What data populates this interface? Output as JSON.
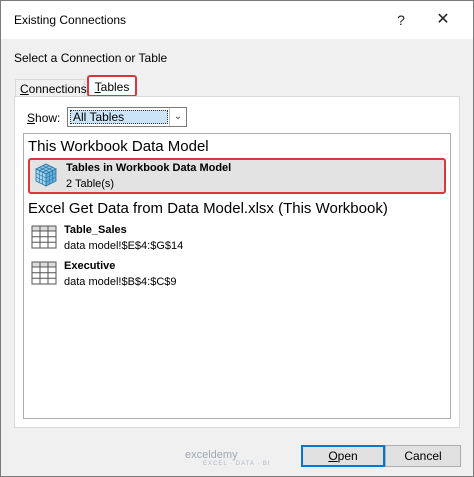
{
  "window": {
    "title": "Existing Connections",
    "help_label": "?",
    "close_label": "✕"
  },
  "prompt": "Select a Connection or Table",
  "tabs": [
    {
      "label_first": "C",
      "label_rest": "onnections"
    },
    {
      "label_first": "T",
      "label_rest": "ables"
    }
  ],
  "show": {
    "label_first": "S",
    "label_rest": "how:",
    "value": "All Tables"
  },
  "groups": [
    {
      "header": "This Workbook Data Model",
      "items": [
        {
          "name": "Tables in Workbook Data Model",
          "detail": "2 Table(s)",
          "icon": "data-model-cube-icon"
        }
      ]
    },
    {
      "header": "Excel Get Data from Data Model.xlsx (This Workbook)",
      "items": [
        {
          "name": "Table_Sales",
          "detail": "data model!$E$4:$G$14",
          "icon": "table-grid-icon"
        },
        {
          "name": "Executive",
          "detail": "data model!$B$4:$C$9",
          "icon": "table-grid-icon"
        }
      ]
    }
  ],
  "watermark": {
    "brand": "exceldemy",
    "tagline": "EXCEL · DATA · BI"
  },
  "buttons": {
    "open_first": "O",
    "open_rest": "pen",
    "cancel": "Cancel"
  },
  "colors": {
    "highlight_border": "#d9363e",
    "selected_value_bg": "#cce4f7",
    "default_button_border": "#0078d7"
  }
}
